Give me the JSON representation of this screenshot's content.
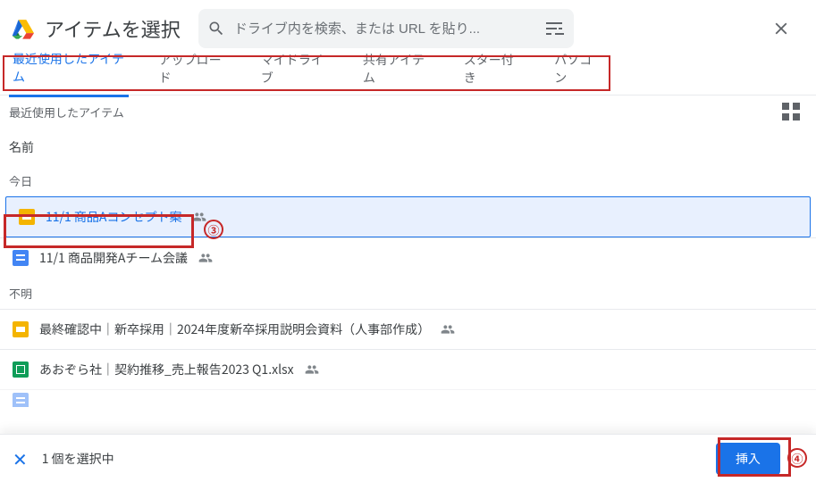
{
  "header": {
    "title": "アイテムを選択",
    "search_placeholder": "ドライブ内を検索、または URL を貼り..."
  },
  "tabs": [
    {
      "label": "最近使用したアイテム",
      "active": true
    },
    {
      "label": "アップロード",
      "active": false
    },
    {
      "label": "マイドライブ",
      "active": false
    },
    {
      "label": "共有アイテム",
      "active": false
    },
    {
      "label": "スター付き",
      "active": false
    },
    {
      "label": "パソコン",
      "active": false
    }
  ],
  "section_label": "最近使用したアイテム",
  "column_header": "名前",
  "groups": [
    {
      "label": "今日",
      "files": [
        {
          "icon": "slides",
          "name": "11/1 商品Aコンセプト案",
          "shared": true,
          "selected": true
        },
        {
          "icon": "docs",
          "name": "11/1 商品開発Aチーム会議",
          "shared": true,
          "selected": false
        }
      ]
    },
    {
      "label": "不明",
      "files": [
        {
          "icon": "slides",
          "name": "最終確認中｜新卒採用｜2024年度新卒採用説明会資料（人事部作成）",
          "shared": true,
          "selected": false
        },
        {
          "icon": "sheets",
          "name": "あおぞら社｜契約推移_売上報告2023 Q1.xlsx",
          "shared": true,
          "selected": false
        }
      ]
    }
  ],
  "footer": {
    "selection_text": "1 個を選択中",
    "insert_label": "挿入"
  },
  "annotations": {
    "step3": "③",
    "step4": "④"
  }
}
